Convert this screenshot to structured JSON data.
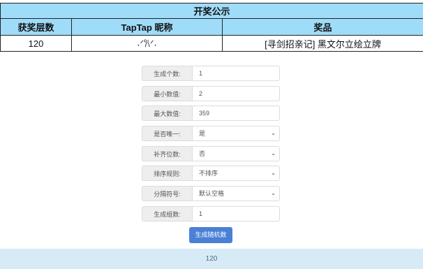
{
  "table": {
    "title": "开奖公示",
    "headers": [
      "获奖层数",
      "TapTap 昵称",
      "奖品"
    ],
    "row": {
      "floor": "120",
      "nickname": "˖ᐟ𐙚ᐟ˖",
      "prize": "[寻剑招亲记] 黑文尔立绘立牌"
    }
  },
  "form": {
    "fields": [
      {
        "label": "生成个数:",
        "value": "1",
        "type": "input"
      },
      {
        "label": "最小数值:",
        "value": "2",
        "type": "input"
      },
      {
        "label": "最大数值:",
        "value": "359",
        "type": "input"
      },
      {
        "label": "是否唯一:",
        "value": "是",
        "type": "select"
      },
      {
        "label": "补齐位数:",
        "value": "否",
        "type": "select"
      },
      {
        "label": "排序规则:",
        "value": "不排序",
        "type": "select"
      },
      {
        "label": "分隔符号:",
        "value": "默认空格",
        "type": "select"
      },
      {
        "label": "生成组数:",
        "value": "1",
        "type": "input"
      }
    ],
    "submit_label": "生成随机数",
    "caret_icon": "chevron-down-icon"
  },
  "result": {
    "value": "120"
  },
  "colors": {
    "header_bg": "#9fdcfa",
    "button_bg": "#4a80d6",
    "footer_bg": "#d7ebf7"
  }
}
